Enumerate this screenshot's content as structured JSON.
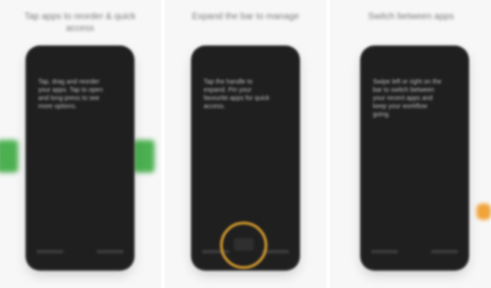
{
  "panels": [
    {
      "caption": "Tap apps to reorder & quick access",
      "screen_text": "Tap, drag and reorder your apps. Tap to open and long-press to see more options."
    },
    {
      "caption": "Expand the bar to manage",
      "screen_text": "Tap the handle to expand. Pin your favourite apps for quick access."
    },
    {
      "caption": "Switch between apps",
      "screen_text": "Swipe left or right on the bar to switch between your recent apps and keep your workflow going."
    }
  ],
  "colors": {
    "background": "#f7f7f7",
    "phone": "#1f1f1f",
    "accent_green": "#4caf50",
    "accent_orange": "#d39a2e"
  }
}
